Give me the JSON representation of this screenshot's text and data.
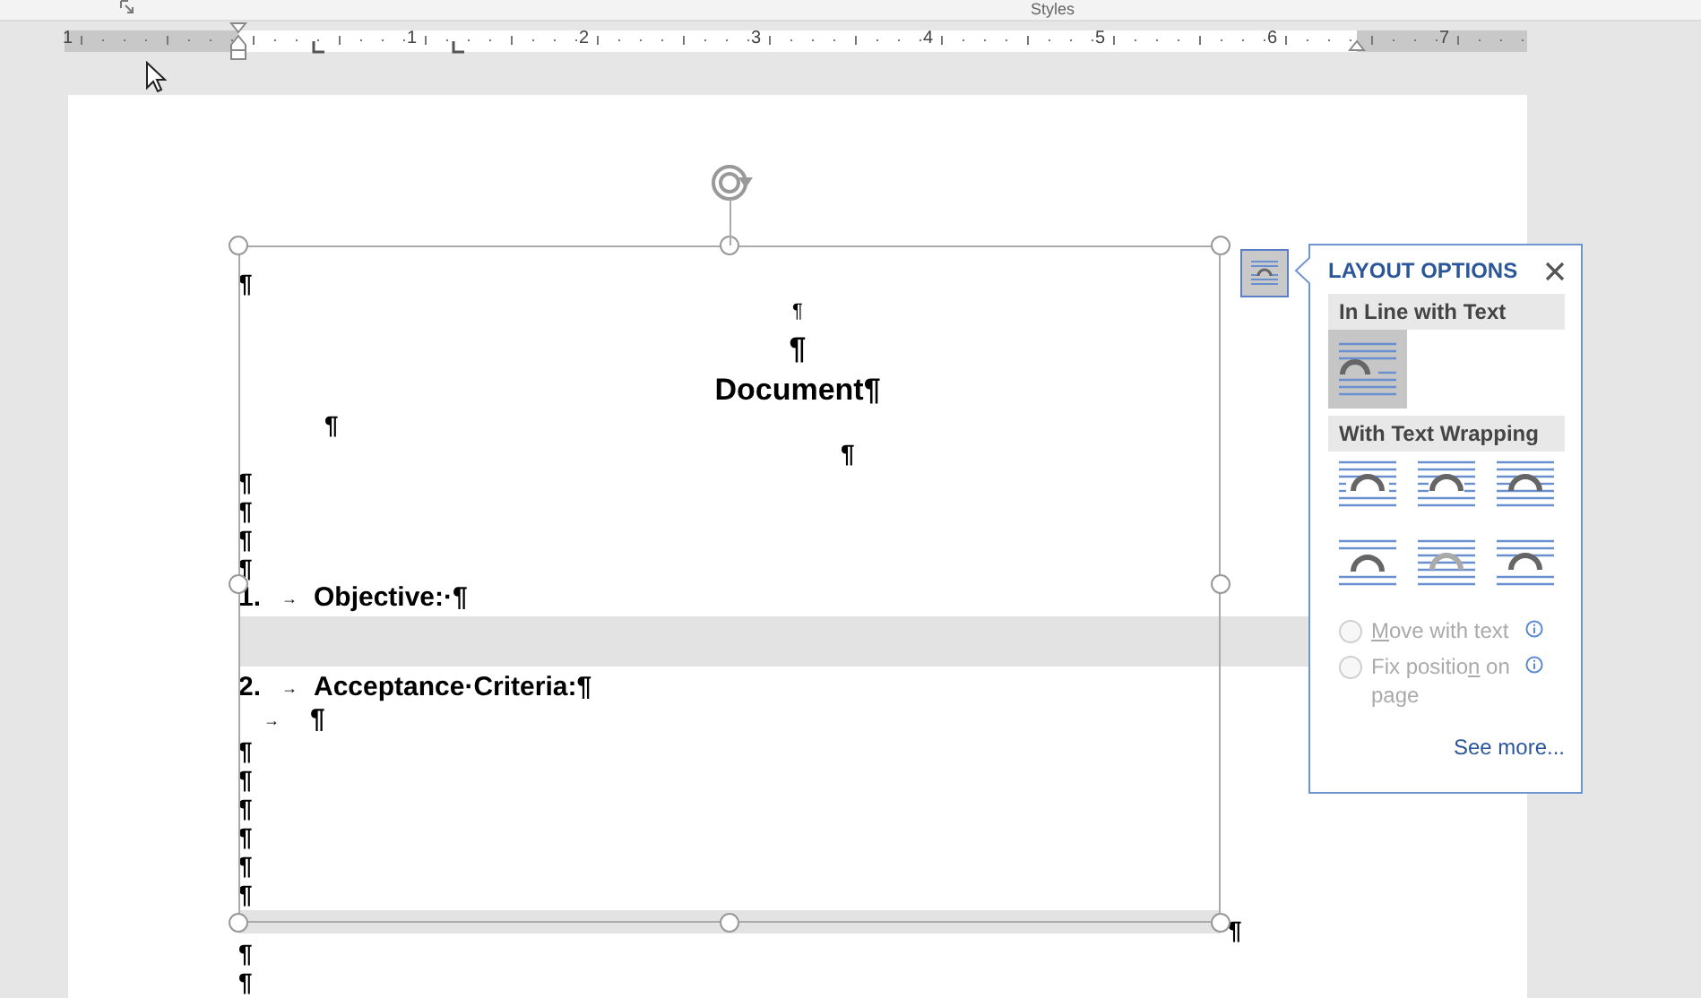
{
  "ribbon": {
    "group_label": "Styles"
  },
  "ruler": {
    "labels": [
      "1",
      "1",
      "2",
      "3",
      "4",
      "5",
      "6",
      "7"
    ]
  },
  "document": {
    "lines": [
      {
        "kind": "para",
        "text": "¶"
      },
      {
        "kind": "para",
        "text": "¶"
      },
      {
        "kind": "para",
        "text": "¶"
      },
      {
        "kind": "para",
        "text": "Document¶"
      },
      {
        "kind": "para",
        "text": "¶"
      },
      {
        "kind": "para",
        "text": "¶"
      },
      {
        "kind": "para",
        "text": "¶"
      },
      {
        "kind": "para",
        "text": "¶"
      },
      {
        "kind": "para",
        "text": "¶"
      },
      {
        "kind": "para",
        "text": "¶"
      },
      {
        "kind": "list",
        "number": "1.",
        "tab": "→",
        "text": "Objective:·¶"
      },
      {
        "kind": "shaded"
      },
      {
        "kind": "list",
        "number": "2.",
        "tab": "→",
        "text": "Acceptance·Criteria:¶"
      },
      {
        "kind": "tab",
        "tab": "→",
        "text": "¶"
      },
      {
        "kind": "para",
        "text": "¶"
      },
      {
        "kind": "para",
        "text": "¶"
      },
      {
        "kind": "para",
        "text": "¶"
      },
      {
        "kind": "para",
        "text": "¶"
      },
      {
        "kind": "para",
        "text": "¶"
      },
      {
        "kind": "para",
        "text": "¶"
      },
      {
        "kind": "shaded",
        "text": "¶"
      },
      {
        "kind": "para",
        "text": "¶"
      },
      {
        "kind": "para",
        "text": "¶"
      }
    ]
  },
  "layout_options": {
    "title": "LAYOUT OPTIONS",
    "sections": [
      {
        "heading": "In Line with Text",
        "options": [
          {
            "kind": "inline",
            "selected": true
          }
        ]
      },
      {
        "heading": "With Text Wrapping",
        "options": [
          {
            "kind": "square",
            "selected": false
          },
          {
            "kind": "tight",
            "selected": false
          },
          {
            "kind": "through",
            "selected": false
          },
          {
            "kind": "top-bottom",
            "selected": false
          },
          {
            "kind": "behind",
            "selected": false
          },
          {
            "kind": "front",
            "selected": false
          }
        ]
      }
    ],
    "radios": [
      {
        "key": "M",
        "after": "ove with text",
        "checked": false,
        "disabled": true
      },
      {
        "before": "Fix positio",
        "key": "n",
        "after": " on page",
        "checked": false,
        "disabled": true
      }
    ],
    "link": "See more..."
  }
}
